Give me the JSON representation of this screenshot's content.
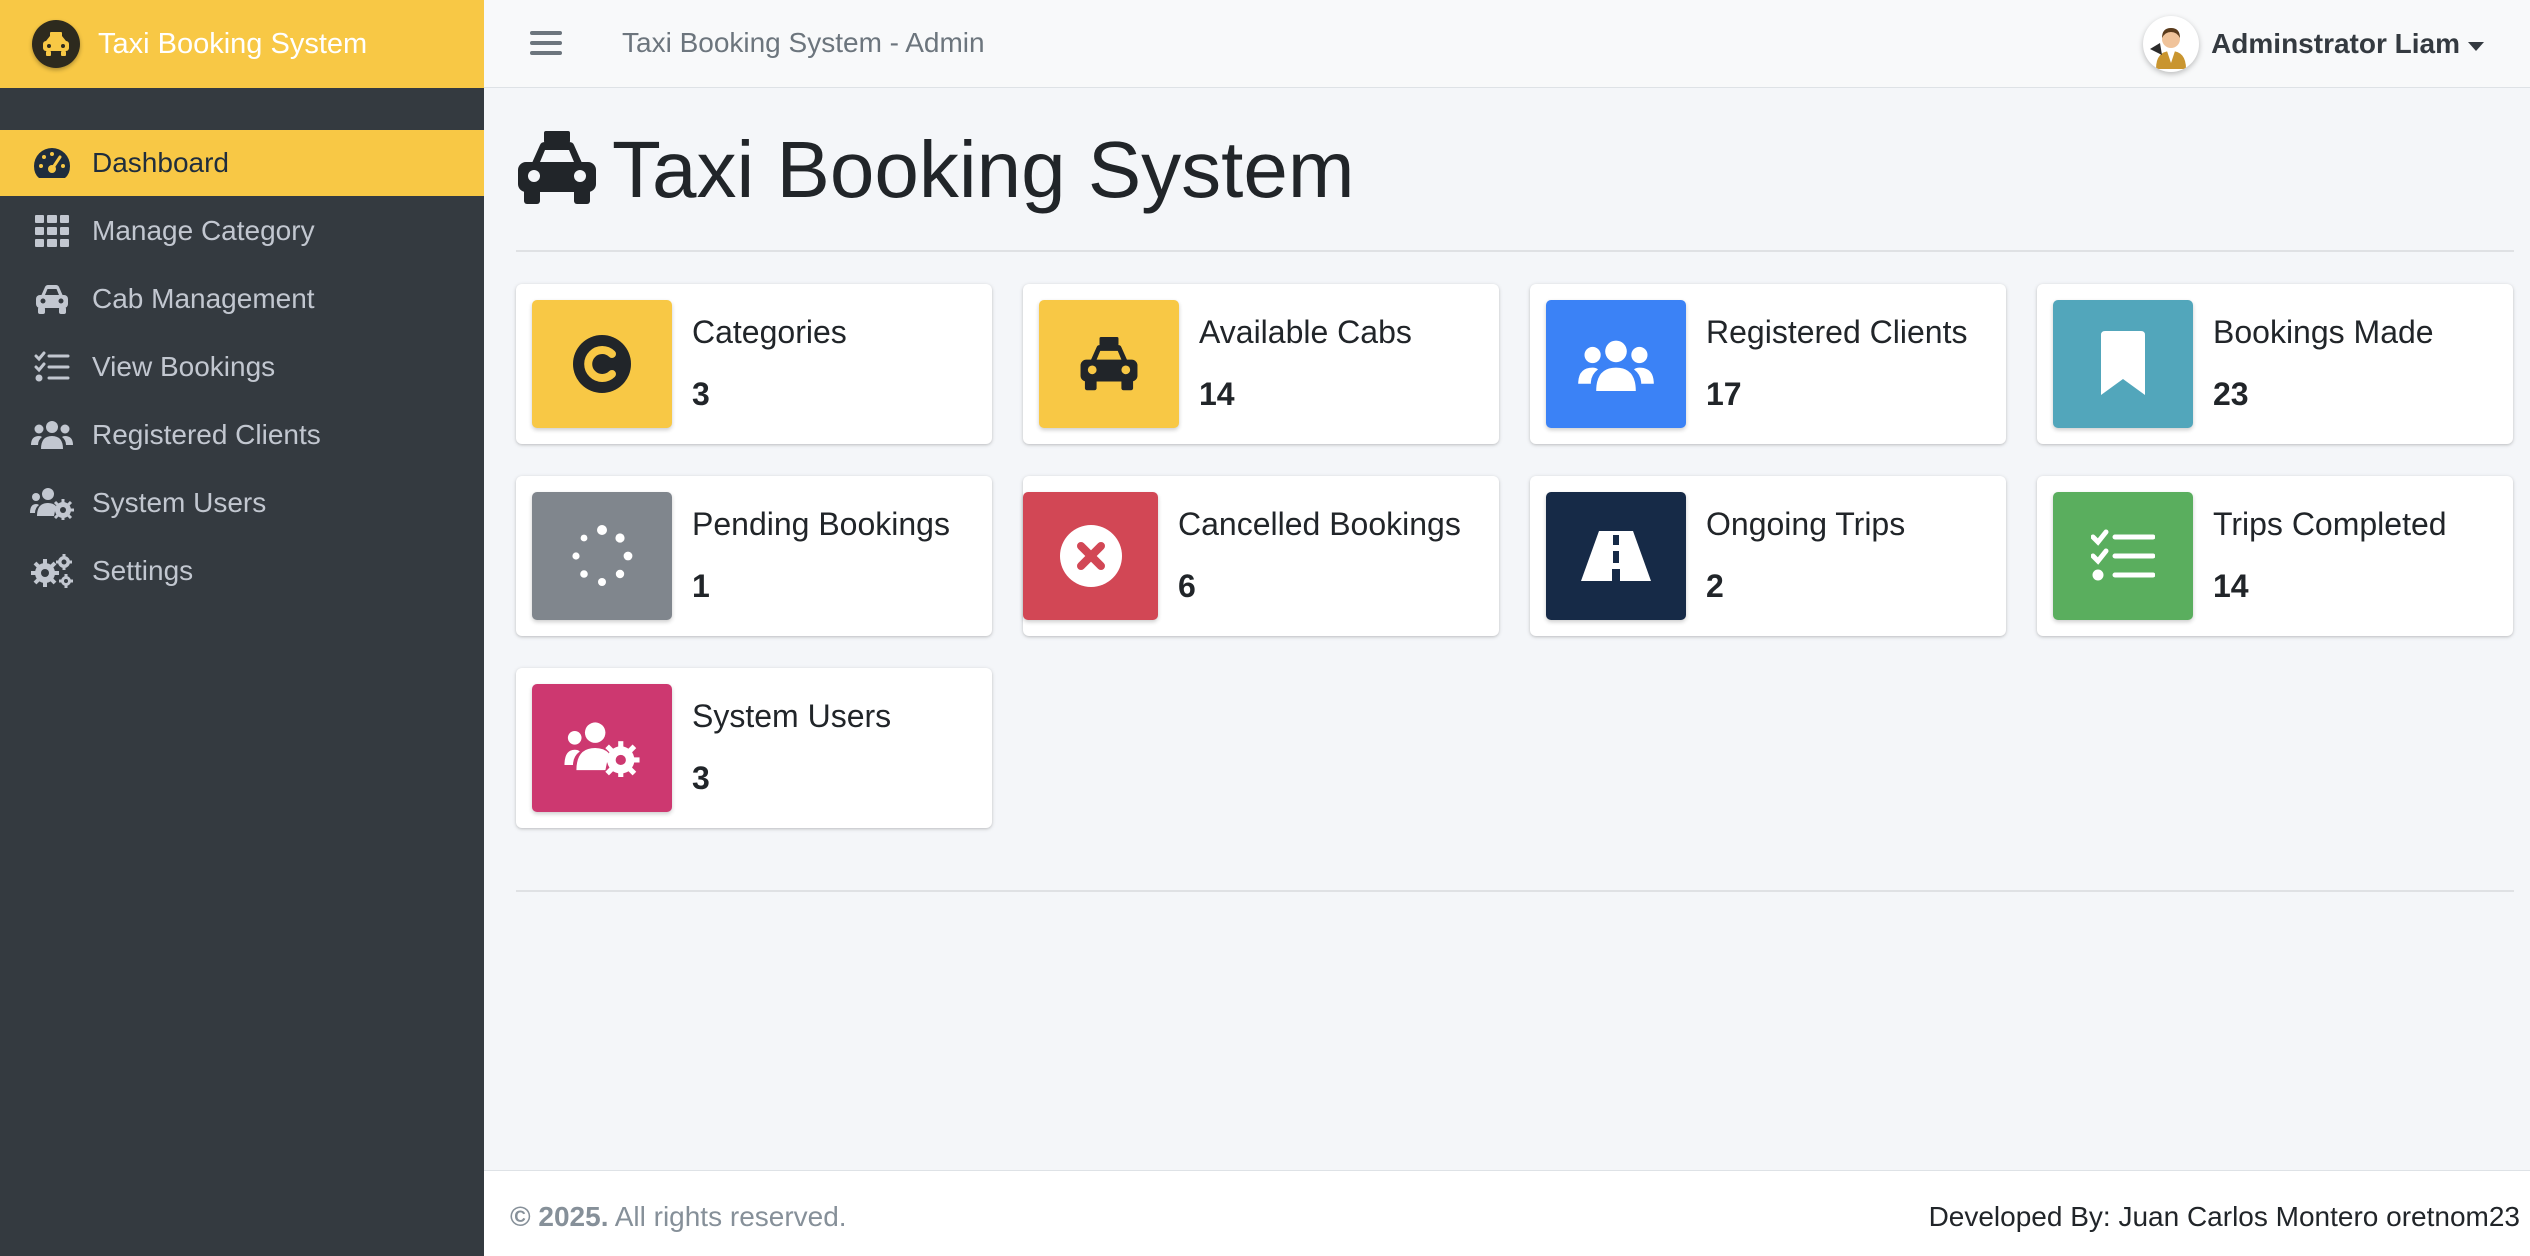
{
  "brand": {
    "title": "Taxi Booking System"
  },
  "sidebar": {
    "items": [
      {
        "label": "Dashboard",
        "icon": "tachometer-icon",
        "active": true
      },
      {
        "label": "Manage Category",
        "icon": "grid-icon"
      },
      {
        "label": "Cab Management",
        "icon": "car-icon"
      },
      {
        "label": "View Bookings",
        "icon": "tasks-icon"
      },
      {
        "label": "Registered Clients",
        "icon": "users-icon"
      },
      {
        "label": "System Users",
        "icon": "users-cog-icon"
      },
      {
        "label": "Settings",
        "icon": "cogs-icon"
      }
    ]
  },
  "topbar": {
    "title": "Taxi Booking System - Admin",
    "user_name": "Adminstrator Liam"
  },
  "main": {
    "title": "Taxi Booking System"
  },
  "cards": [
    {
      "label": "Categories",
      "value": "3",
      "color": "#f8c845",
      "icon": "copyright-icon"
    },
    {
      "label": "Available Cabs",
      "value": "14",
      "color": "#f8c845",
      "icon": "taxi-icon"
    },
    {
      "label": "Registered Clients",
      "value": "17",
      "color": "#3b82f6",
      "icon": "users-icon"
    },
    {
      "label": "Bookings Made",
      "value": "23",
      "color": "#52a6bb",
      "icon": "bookmark-icon"
    },
    {
      "label": "Pending Bookings",
      "value": "1",
      "color": "#80868d",
      "icon": "spinner-icon"
    },
    {
      "label": "Cancelled Bookings",
      "value": "6",
      "color": "#d24755",
      "icon": "times-circle-icon"
    },
    {
      "label": "Ongoing Trips",
      "value": "2",
      "color": "#162a47",
      "icon": "road-icon"
    },
    {
      "label": "Trips Completed",
      "value": "14",
      "color": "#5aae5e",
      "icon": "checklist-icon"
    },
    {
      "label": "System Users",
      "value": "3",
      "color": "#cd3870",
      "icon": "users-cog-icon"
    }
  ],
  "footer": {
    "copyright": "© 2025.",
    "rights": "All rights reserved.",
    "developer": "Developed By: Juan Carlos Montero oretnom23"
  }
}
